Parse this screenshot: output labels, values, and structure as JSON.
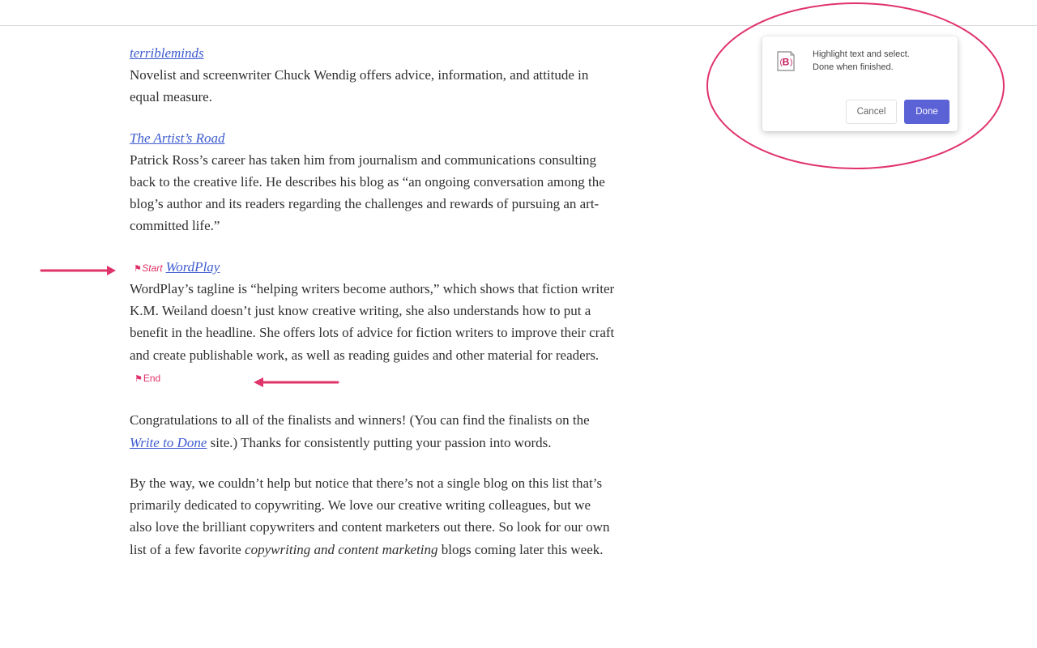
{
  "article": {
    "entries": [
      {
        "title": "terribleminds",
        "description": "Novelist and screenwriter Chuck Wendig offers advice, information, and attitude in equal measure."
      },
      {
        "title": "The Artist’s Road",
        "description": "Patrick Ross’s career has taken him from journalism and communications consulting back to the creative life. He describes his blog as “an ongoing conversation among the blog’s author and its readers regarding the challenges and rewards of pursuing an art-committed life.”"
      },
      {
        "title": "WordPlay",
        "description": "WordPlay’s tagline is “helping writers become authors,” which shows that fiction writer K.M. Weiland doesn’t just know creative writing, she also understands how to put a benefit in the headline. She offers lots of advice for fiction writers to improve their craft and create publishable work, as well as reading guides and other material for readers."
      }
    ],
    "congrats": {
      "before_link": "Congratulations to all of the finalists and winners! (You can find the finalists on the ",
      "link": "Write to Done",
      "after_link": " site.) Thanks for consistently putting your passion into words."
    },
    "closing": {
      "before_em": "By the way, we couldn’t help but notice that there’s not a single blog on this list that’s primarily dedicated to copywriting. We love our creative writing colleagues, but we also love the brilliant copywriters and content marketers out there. So look for our own list of a few favorite ",
      "em": "copywriting and content marketing",
      "after_em": " blogs coming later this week."
    }
  },
  "markers": {
    "start_label": "Start",
    "end_label": "End",
    "flag_icon": "checkered-flag-icon",
    "color": "#e0336a"
  },
  "popup": {
    "logo_letter": "B",
    "message_line1": "Highlight text and select.",
    "message_line2": "Done when finished.",
    "cancel_label": "Cancel",
    "done_label": "Done",
    "accent_color": "#5b62d6"
  },
  "annotation": {
    "color": "#e0336a"
  }
}
